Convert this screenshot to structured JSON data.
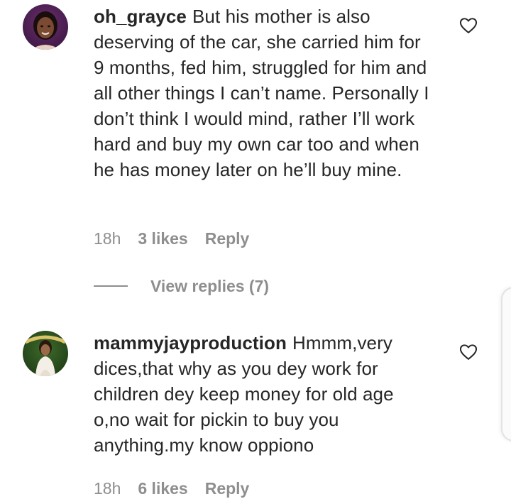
{
  "comments": [
    {
      "username": "oh_grayce",
      "text": "But his mother is also deserving of the car, she carried him for 9 months, fed him, struggled for him and all other things I can’t name. Personally I don’t think I would mind, rather I’ll work hard and buy my own car too and when he has money later on he’ll buy mine.",
      "time": "18h",
      "likes": "3 likes",
      "reply": "Reply",
      "view_replies": "View replies (7)"
    },
    {
      "username": "mammyjayproduction",
      "text": "Hmmm,very dices,that why as you dey work for children dey keep money for old age o,no wait for pickin to buy you anything.my know oppiono",
      "time": "18h",
      "likes": "6 likes",
      "reply": "Reply"
    }
  ],
  "icons": {
    "like": "heart-outline-icon"
  },
  "colors": {
    "text": "#262626",
    "meta": "#8e8e8e",
    "background": "#ffffff"
  }
}
